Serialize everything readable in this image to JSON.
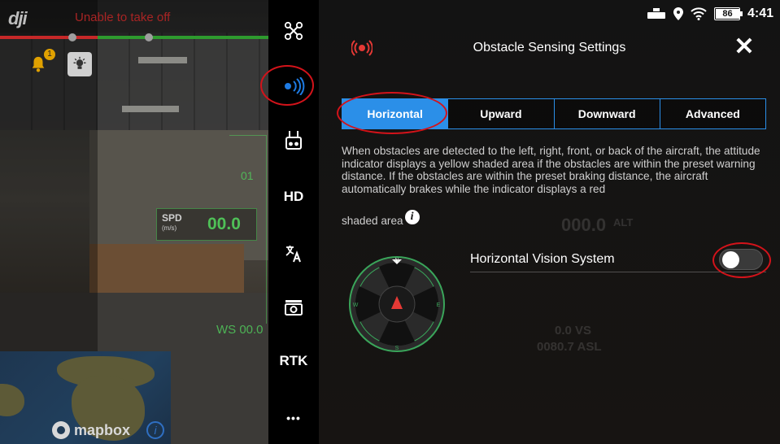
{
  "camera_view": {
    "logo": "dji",
    "status_text": "Unable to take off",
    "notification_count": "1",
    "speed": {
      "label": "SPD",
      "unit": "(m/s)",
      "value": "00.0"
    },
    "wind_speed": "WS 00.0",
    "heading_tick": "01",
    "map": {
      "brand": "mapbox"
    }
  },
  "menu": {
    "items": [
      {
        "name": "aircraft",
        "icon": "drone-icon"
      },
      {
        "name": "obstacle-sensing",
        "icon": "sensor-waves-icon",
        "active": true
      },
      {
        "name": "remote-controller",
        "icon": "remote-controller-icon"
      },
      {
        "name": "hd",
        "label": "HD"
      },
      {
        "name": "battery-language",
        "icon": "translate-icon"
      },
      {
        "name": "camera",
        "icon": "camera-icon"
      },
      {
        "name": "rtk",
        "label": "RTK"
      },
      {
        "name": "more",
        "label": "•••"
      }
    ]
  },
  "system_bar": {
    "battery_percent": "86",
    "time": "4:41"
  },
  "panel": {
    "title": "Obstacle Sensing Settings",
    "close_label": "✕",
    "tabs": [
      "Horizontal",
      "Upward",
      "Downward",
      "Advanced"
    ],
    "selected_tab": "Horizontal",
    "description": "When obstacles are detected to the left, right, front, or back of the aircraft, the attitude indicator displays a yellow shaded area if the obstacles are within the preset warning distance. If the obstacles are within the preset braking distance, the aircraft automatically brakes while the indicator displays a red",
    "description_tail": "shaded area",
    "info_label": "i",
    "setting": {
      "label": "Horizontal Vision System",
      "enabled": false
    },
    "compass_letters": [
      "N",
      "E",
      "S",
      "W"
    ],
    "background_overlay": {
      "alt_label": "ALT",
      "alt_value": "000.0",
      "vs_text": "0.0  VS",
      "asl_text": "0080.7 ASL"
    }
  },
  "colors": {
    "accent": "#2b8fe8",
    "annotation": "#d3131a",
    "hud_green": "#50c85a",
    "warning_red": "#c62828"
  }
}
